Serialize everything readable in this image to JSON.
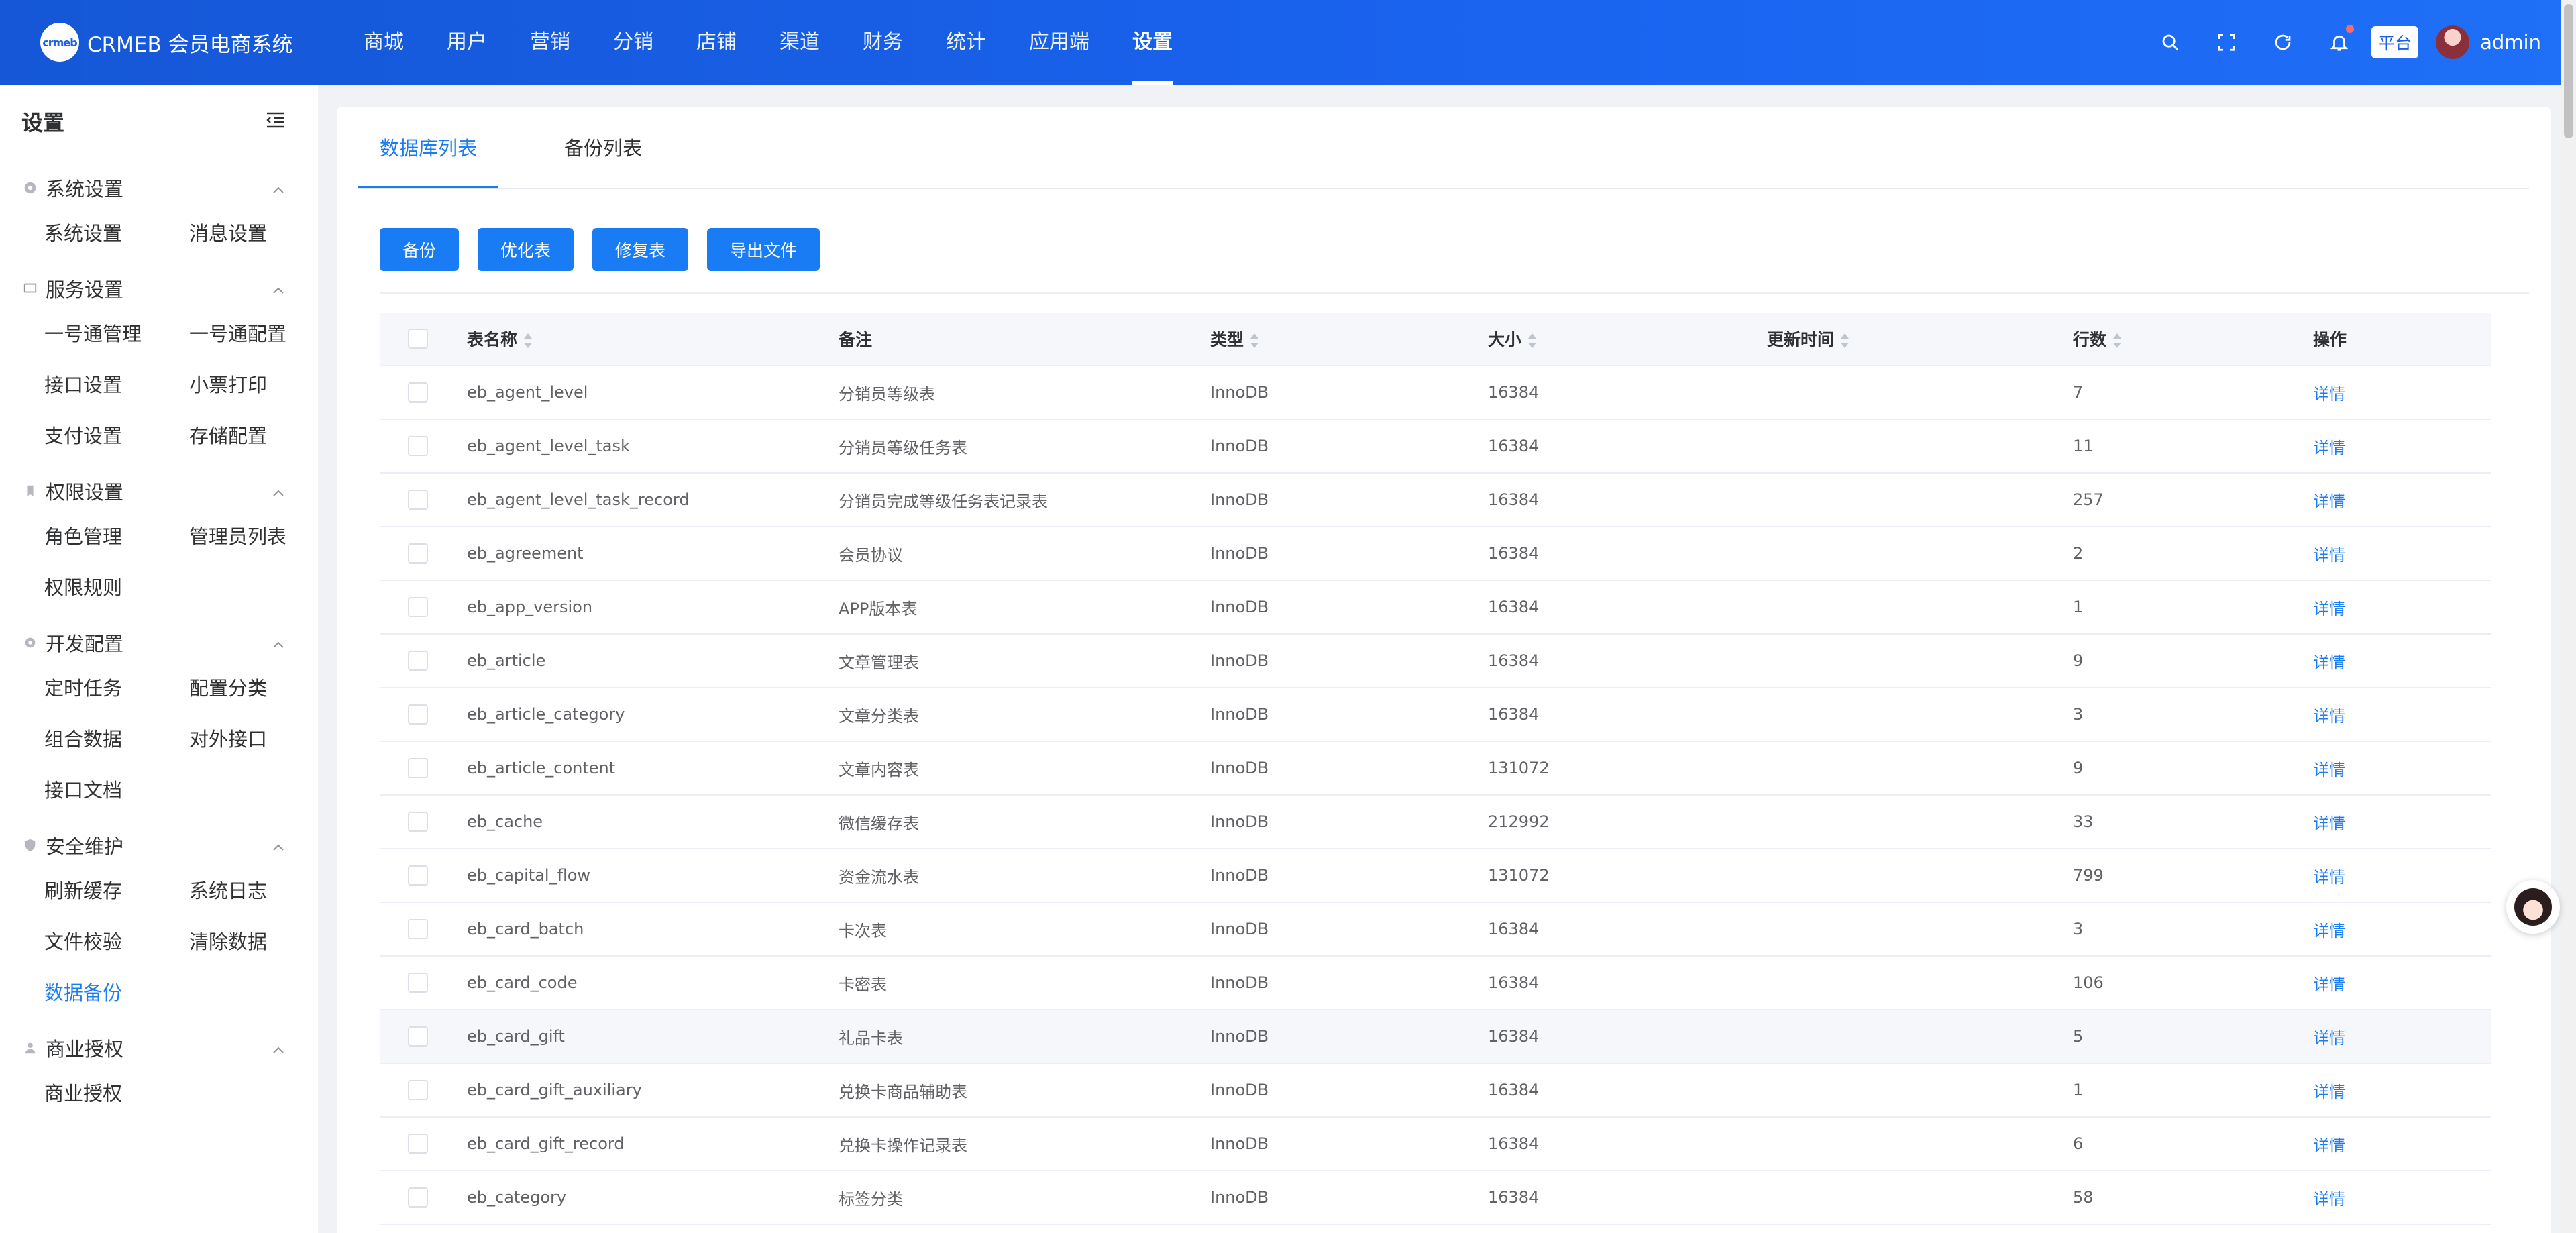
{
  "header": {
    "logo_mark": "crmeb",
    "logo_text": "CRMEB 会员电商系统",
    "nav": [
      "商城",
      "用户",
      "营销",
      "分销",
      "店铺",
      "渠道",
      "财务",
      "统计",
      "应用端",
      "设置"
    ],
    "active_nav": "设置",
    "platform_tag": "平台",
    "admin_name": "admin"
  },
  "sidebar": {
    "title": "设置",
    "groups": [
      {
        "label": "系统设置",
        "icon": "gear-icon",
        "items": [
          "系统设置",
          "消息设置"
        ]
      },
      {
        "label": "服务设置",
        "icon": "monitor-icon",
        "items": [
          "一号通管理",
          "一号通配置",
          "接口设置",
          "小票打印",
          "支付设置",
          "存储配置"
        ]
      },
      {
        "label": "权限设置",
        "icon": "bookmark-icon",
        "items": [
          "角色管理",
          "管理员列表",
          "权限规则"
        ]
      },
      {
        "label": "开发配置",
        "icon": "cog-icon",
        "items": [
          "定时任务",
          "配置分类",
          "组合数据",
          "对外接口",
          "接口文档"
        ]
      },
      {
        "label": "安全维护",
        "icon": "shield-icon",
        "items": [
          "刷新缓存",
          "系统日志",
          "文件校验",
          "清除数据",
          "数据备份"
        ]
      },
      {
        "label": "商业授权",
        "icon": "user-icon",
        "items": [
          "商业授权"
        ]
      }
    ],
    "active_item": "数据备份"
  },
  "tabs": [
    "数据库列表",
    "备份列表"
  ],
  "active_tab": "数据库列表",
  "toolbar": {
    "backup": "备份",
    "optimize": "优化表",
    "repair": "修复表",
    "export": "导出文件"
  },
  "table": {
    "headers": {
      "name": "表名称",
      "comment": "备注",
      "type": "类型",
      "size": "大小",
      "updated": "更新时间",
      "rows": "行数",
      "action": "操作"
    },
    "rows": [
      {
        "name": "eb_agent_level",
        "comment": "分销员等级表",
        "type": "InnoDB",
        "size": "16384",
        "updated": "",
        "rows": "7",
        "action": "详情"
      },
      {
        "name": "eb_agent_level_task",
        "comment": "分销员等级任务表",
        "type": "InnoDB",
        "size": "16384",
        "updated": "",
        "rows": "11",
        "action": "详情"
      },
      {
        "name": "eb_agent_level_task_record",
        "comment": "分销员完成等级任务表记录表",
        "type": "InnoDB",
        "size": "16384",
        "updated": "",
        "rows": "257",
        "action": "详情"
      },
      {
        "name": "eb_agreement",
        "comment": "会员协议",
        "type": "InnoDB",
        "size": "16384",
        "updated": "",
        "rows": "2",
        "action": "详情"
      },
      {
        "name": "eb_app_version",
        "comment": "APP版本表",
        "type": "InnoDB",
        "size": "16384",
        "updated": "",
        "rows": "1",
        "action": "详情"
      },
      {
        "name": "eb_article",
        "comment": "文章管理表",
        "type": "InnoDB",
        "size": "16384",
        "updated": "",
        "rows": "9",
        "action": "详情"
      },
      {
        "name": "eb_article_category",
        "comment": "文章分类表",
        "type": "InnoDB",
        "size": "16384",
        "updated": "",
        "rows": "3",
        "action": "详情"
      },
      {
        "name": "eb_article_content",
        "comment": "文章内容表",
        "type": "InnoDB",
        "size": "131072",
        "updated": "",
        "rows": "9",
        "action": "详情"
      },
      {
        "name": "eb_cache",
        "comment": "微信缓存表",
        "type": "InnoDB",
        "size": "212992",
        "updated": "",
        "rows": "33",
        "action": "详情"
      },
      {
        "name": "eb_capital_flow",
        "comment": "资金流水表",
        "type": "InnoDB",
        "size": "131072",
        "updated": "",
        "rows": "799",
        "action": "详情"
      },
      {
        "name": "eb_card_batch",
        "comment": "卡次表",
        "type": "InnoDB",
        "size": "16384",
        "updated": "",
        "rows": "3",
        "action": "详情"
      },
      {
        "name": "eb_card_code",
        "comment": "卡密表",
        "type": "InnoDB",
        "size": "16384",
        "updated": "",
        "rows": "106",
        "action": "详情"
      },
      {
        "name": "eb_card_gift",
        "comment": "礼品卡表",
        "type": "InnoDB",
        "size": "16384",
        "updated": "",
        "rows": "5",
        "action": "详情"
      },
      {
        "name": "eb_card_gift_auxiliary",
        "comment": "兑换卡商品辅助表",
        "type": "InnoDB",
        "size": "16384",
        "updated": "",
        "rows": "1",
        "action": "详情"
      },
      {
        "name": "eb_card_gift_record",
        "comment": "兑换卡操作记录表",
        "type": "InnoDB",
        "size": "16384",
        "updated": "",
        "rows": "6",
        "action": "详情"
      },
      {
        "name": "eb_category",
        "comment": "标签分类",
        "type": "InnoDB",
        "size": "16384",
        "updated": "",
        "rows": "58",
        "action": "详情"
      }
    ]
  }
}
